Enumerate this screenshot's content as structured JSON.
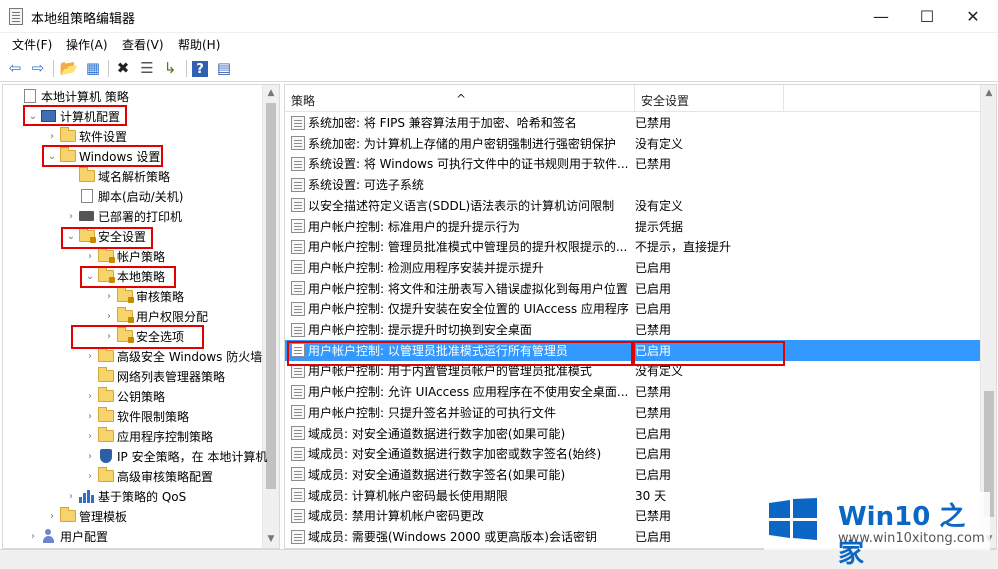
{
  "window": {
    "title": "本地组策略编辑器",
    "minimize": "—",
    "maximize": "☐",
    "close": "✕"
  },
  "menu": [
    "文件(F)",
    "操作(A)",
    "查看(V)",
    "帮助(H)"
  ],
  "toolbar": {
    "icons": [
      "back-arrow-icon",
      "forward-arrow-icon",
      "up-folder-icon",
      "show-hide-tree-icon",
      "delete-icon",
      "properties-icon",
      "export-list-icon",
      "help-icon",
      "view-icon"
    ],
    "glyphs": [
      "⇦",
      "⇨",
      "📂",
      "▦",
      "✖",
      "☰",
      "↳",
      "?",
      "▤"
    ]
  },
  "tree": {
    "items": [
      {
        "label": "本地计算机 策略",
        "level": 0,
        "twisty": "",
        "icon": "doc"
      },
      {
        "label": "计算机配置",
        "level": 1,
        "twisty": "⌄",
        "icon": "computer"
      },
      {
        "label": "软件设置",
        "level": 2,
        "twisty": "›",
        "icon": "folder"
      },
      {
        "label": "Windows 设置",
        "level": 2,
        "twisty": "⌄",
        "icon": "folder"
      },
      {
        "label": "域名解析策略",
        "level": 3,
        "twisty": "",
        "icon": "folder"
      },
      {
        "label": "脚本(启动/关机)",
        "level": 3,
        "twisty": "",
        "icon": "doc"
      },
      {
        "label": "已部署的打印机",
        "level": 3,
        "twisty": "›",
        "icon": "printer"
      },
      {
        "label": "安全设置",
        "level": 3,
        "twisty": "⌄",
        "icon": "lock-folder"
      },
      {
        "label": "帐户策略",
        "level": 4,
        "twisty": "›",
        "icon": "lock-folder"
      },
      {
        "label": "本地策略",
        "level": 4,
        "twisty": "⌄",
        "icon": "lock-folder"
      },
      {
        "label": "审核策略",
        "level": 5,
        "twisty": "›",
        "icon": "lock-folder"
      },
      {
        "label": "用户权限分配",
        "level": 5,
        "twisty": "›",
        "icon": "lock-folder"
      },
      {
        "label": "安全选项",
        "level": 5,
        "twisty": "›",
        "icon": "lock-folder"
      },
      {
        "label": "高级安全 Windows 防火墙",
        "level": 4,
        "twisty": "›",
        "icon": "folder"
      },
      {
        "label": "网络列表管理器策略",
        "level": 4,
        "twisty": "",
        "icon": "folder"
      },
      {
        "label": "公钥策略",
        "level": 4,
        "twisty": "›",
        "icon": "folder"
      },
      {
        "label": "软件限制策略",
        "level": 4,
        "twisty": "›",
        "icon": "folder"
      },
      {
        "label": "应用程序控制策略",
        "level": 4,
        "twisty": "›",
        "icon": "folder"
      },
      {
        "label": "IP 安全策略，在 本地计算机",
        "level": 4,
        "twisty": "›",
        "icon": "shield"
      },
      {
        "label": "高级审核策略配置",
        "level": 4,
        "twisty": "›",
        "icon": "folder"
      },
      {
        "label": "基于策略的 QoS",
        "level": 3,
        "twisty": "›",
        "icon": "chart"
      },
      {
        "label": "管理模板",
        "level": 2,
        "twisty": "›",
        "icon": "folder"
      },
      {
        "label": "用户配置",
        "level": 1,
        "twisty": "›",
        "icon": "person"
      }
    ]
  },
  "list": {
    "columns": [
      "策略",
      "安全设置"
    ],
    "sort_indicator": "^",
    "rows": [
      {
        "policy": "系统加密: 将 FIPS 兼容算法用于加密、哈希和签名",
        "setting": "已禁用"
      },
      {
        "policy": "系统加密: 为计算机上存储的用户密钥强制进行强密钥保护",
        "setting": "没有定义"
      },
      {
        "policy": "系统设置: 将 Windows 可执行文件中的证书规则用于软件...",
        "setting": "已禁用"
      },
      {
        "policy": "系统设置: 可选子系统",
        "setting": ""
      },
      {
        "policy": "以安全描述符定义语言(SDDL)语法表示的计算机访问限制",
        "setting": "没有定义"
      },
      {
        "policy": "用户帐户控制: 标准用户的提升提示行为",
        "setting": "提示凭据"
      },
      {
        "policy": "用户帐户控制: 管理员批准模式中管理员的提升权限提示的...",
        "setting": "不提示，直接提升"
      },
      {
        "policy": "用户帐户控制: 检测应用程序安装并提示提升",
        "setting": "已启用"
      },
      {
        "policy": "用户帐户控制: 将文件和注册表写入错误虚拟化到每用户位置",
        "setting": "已启用"
      },
      {
        "policy": "用户帐户控制: 仅提升安装在安全位置的 UIAccess 应用程序",
        "setting": "已启用"
      },
      {
        "policy": "用户帐户控制: 提示提升时切换到安全桌面",
        "setting": "已禁用"
      },
      {
        "policy": "用户帐户控制: 以管理员批准模式运行所有管理员",
        "setting": "已启用"
      },
      {
        "policy": "用户帐户控制: 用于内置管理员帐户的管理员批准模式",
        "setting": "没有定义"
      },
      {
        "policy": "用户帐户控制: 允许 UIAccess 应用程序在不使用安全桌面...",
        "setting": "已禁用"
      },
      {
        "policy": "用户帐户控制: 只提升签名并验证的可执行文件",
        "setting": "已禁用"
      },
      {
        "policy": "域成员: 对安全通道数据进行数字加密(如果可能)",
        "setting": "已启用"
      },
      {
        "policy": "域成员: 对安全通道数据进行数字加密或数字签名(始终)",
        "setting": "已启用"
      },
      {
        "policy": "域成员: 对安全通道数据进行数字签名(如果可能)",
        "setting": "已启用"
      },
      {
        "policy": "域成员: 计算机帐户密码最长使用期限",
        "setting": "30 天"
      },
      {
        "policy": "域成员: 禁用计算机帐户密码更改",
        "setting": "已禁用"
      },
      {
        "policy": "域成员: 需要强(Windows 2000 或更高版本)会话密钥",
        "setting": "已启用"
      }
    ]
  },
  "watermark": {
    "brand": "Win10 之家",
    "url": "www.win10xitong.com",
    "logo_color": "#0b67c3"
  },
  "colors": {
    "selection": "#3399ff",
    "annotation": "#e20000"
  }
}
